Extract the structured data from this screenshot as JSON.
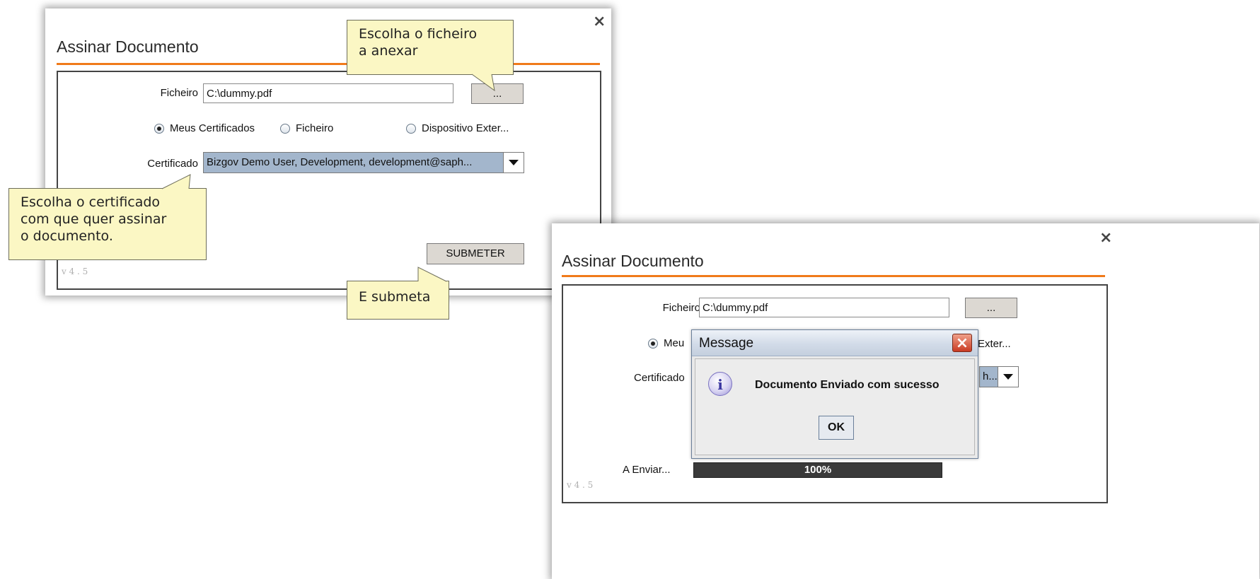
{
  "left_window": {
    "title": "Assinar Documento",
    "close_symbol": "×",
    "file_label": "Ficheiro",
    "file_value": "C:\\dummy.pdf",
    "browse_label": "...",
    "radios": [
      {
        "label": "Meus Certificados",
        "checked": true
      },
      {
        "label": "Ficheiro",
        "checked": false
      },
      {
        "label": "Dispositivo Exter...",
        "checked": false
      }
    ],
    "cert_label": "Certificado",
    "cert_value": "Bizgov Demo User, Development, development@saph...",
    "submit_label": "SUBMETER",
    "version": "v 4 . 5"
  },
  "callouts": {
    "file": "Escolha o ficheiro\na anexar",
    "certificate": "Escolha o certificado\ncom que quer assinar\no documento.",
    "submit": "E submeta"
  },
  "right_window": {
    "title": "Assinar Documento",
    "close_symbol": "×",
    "file_label": "Ficheiro",
    "file_value": "C:\\dummy.pdf",
    "browse_label": "...",
    "radio_partial": "Meu",
    "radio_partial_right": "Exter...",
    "cert_label_partial": "Certificado",
    "cert_value_partial": "h...",
    "sending_label": "A Enviar...",
    "progress": 1.0,
    "progress_text": "100%",
    "version": "v 4 . 5"
  },
  "message_dialog": {
    "title": "Message",
    "close_symbol": "×",
    "icon": "info-icon",
    "icon_glyph": "i",
    "text": "Documento Enviado com sucesso",
    "ok_label": "OK"
  },
  "colors": {
    "accent": "#f07a1a",
    "callout_bg": "#fbf7c4",
    "combo_selected": "#a3b6cc"
  }
}
